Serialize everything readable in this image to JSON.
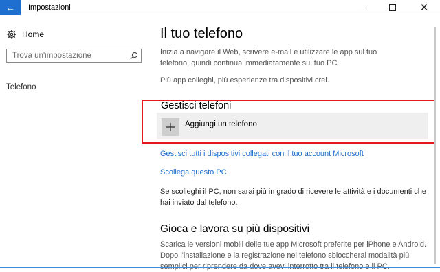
{
  "window": {
    "title": "Impostazioni",
    "back_icon": "←",
    "close_glyph": "✕"
  },
  "sidebar": {
    "home_label": "Home",
    "search": {
      "placeholder": "Trova un'impostazione"
    },
    "items": [
      {
        "label": "Telefono"
      }
    ]
  },
  "main": {
    "title": "Il tuo telefono",
    "intro": "Inizia a navigare il Web, scrivere e-mail e utilizzare le app sul tuo telefono, quindi continua immediatamente sul tuo PC.",
    "intro2": "Più app colleghi, più esperienze tra dispositivi crei.",
    "manage": {
      "heading": "Gestisci telefoni",
      "add_label": "Aggiungi un telefono",
      "plus_glyph": "+",
      "manage_link": "Gestisci tutti i dispositivi collegati con il tuo account Microsoft",
      "unlink_link": "Scollega questo PC",
      "unlink_text": "Se scolleghi il PC, non sarai più in grado di ricevere le attività e i documenti che hai inviato dal telefono."
    },
    "play": {
      "heading": "Gioca e lavora su più dispositivi",
      "text": "Scarica le versioni mobili delle tue app Microsoft preferite per iPhone e Android. Dopo l'installazione e la registrazione nel telefono sbloccherai modalità più semplici per riprendere da dove avevi interrotto tra il telefono e il PC."
    }
  },
  "colors": {
    "accent": "#1f6fd0",
    "link": "#1f6fcf",
    "highlight": "#e4181e"
  }
}
